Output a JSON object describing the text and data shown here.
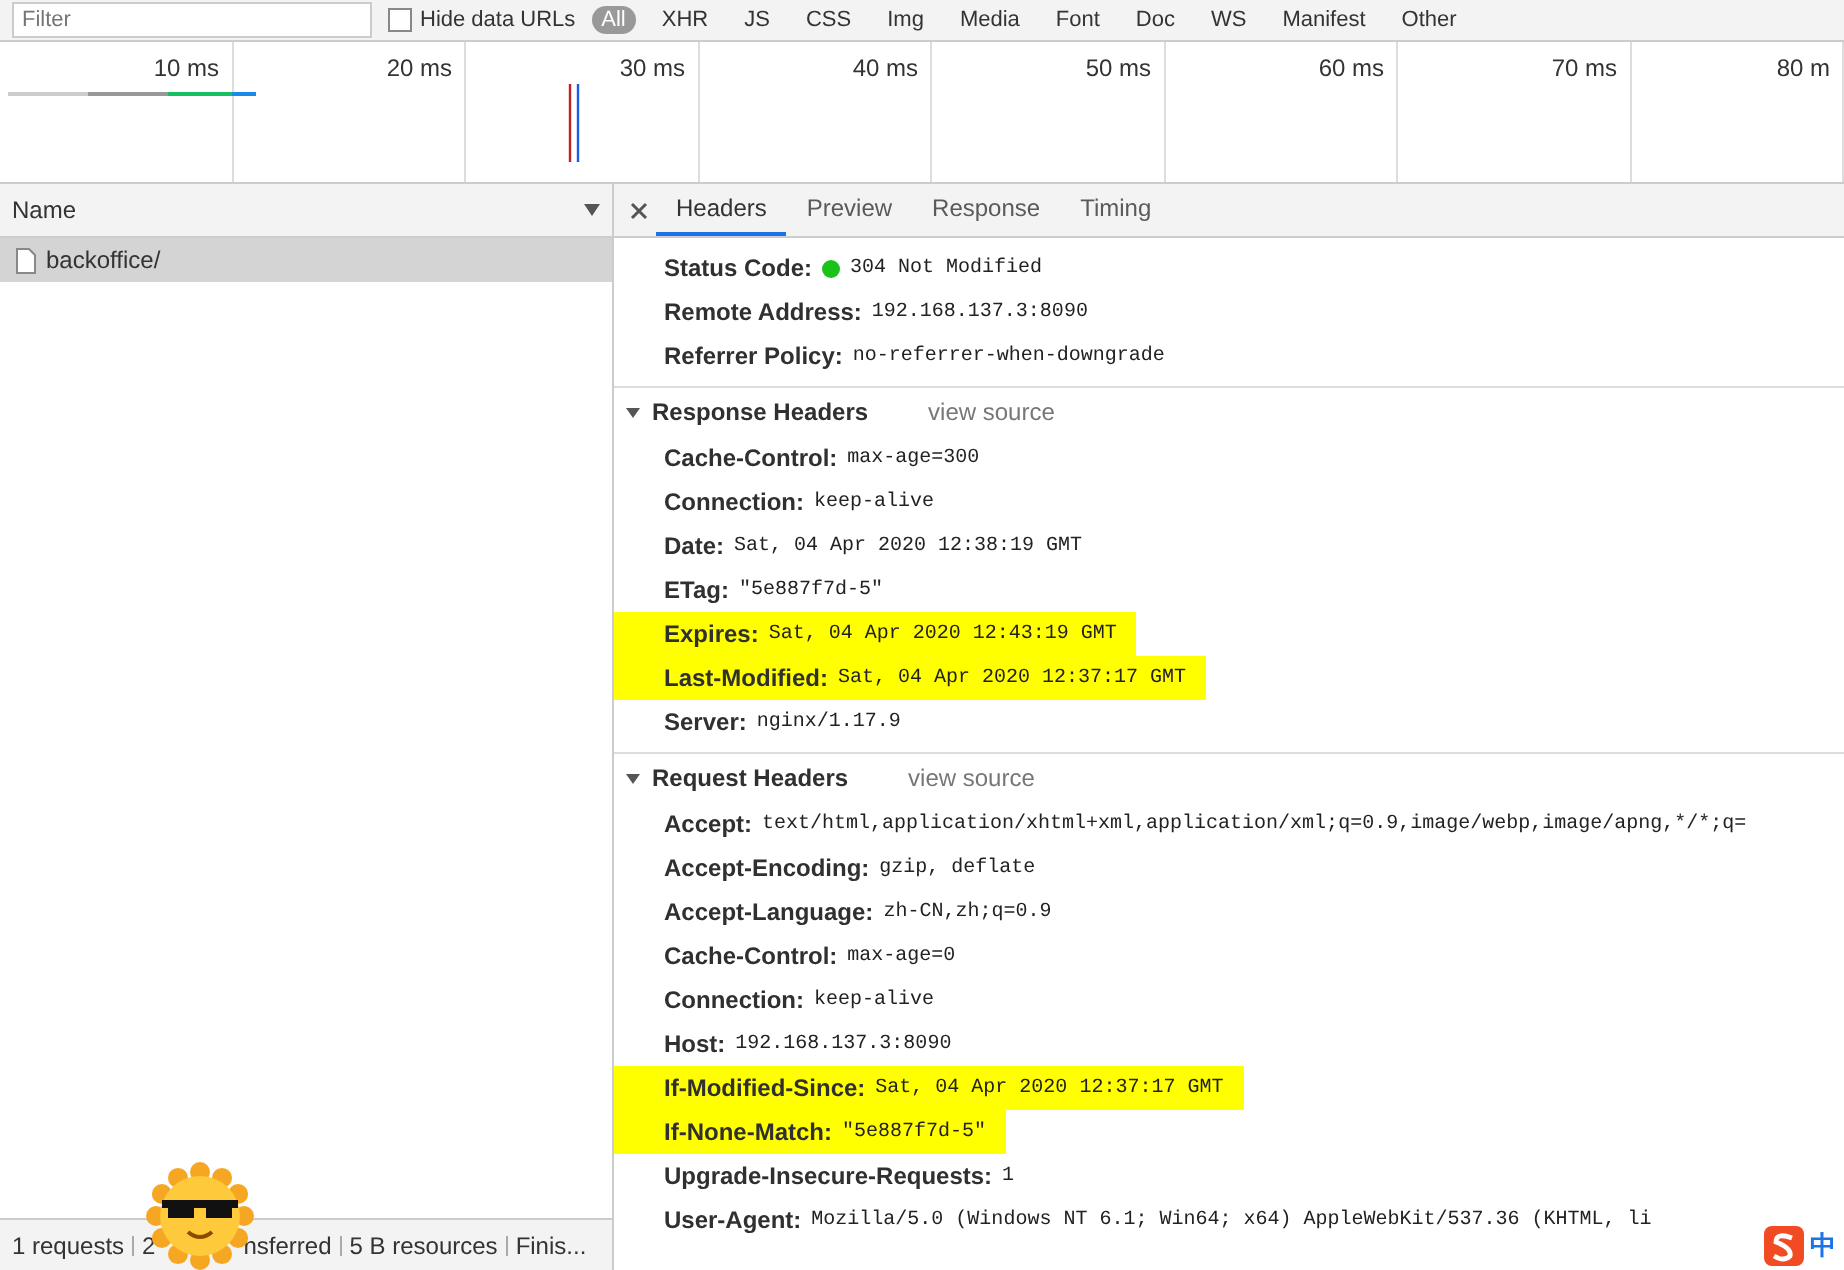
{
  "filter_bar": {
    "placeholder": "Filter",
    "hide_data_urls": {
      "label": "Hide data URLs",
      "checked": false
    },
    "types": [
      {
        "label": "All",
        "selected": true
      },
      {
        "label": "XHR",
        "selected": false
      },
      {
        "label": "JS",
        "selected": false
      },
      {
        "label": "CSS",
        "selected": false
      },
      {
        "label": "Img",
        "selected": false
      },
      {
        "label": "Media",
        "selected": false
      },
      {
        "label": "Font",
        "selected": false
      },
      {
        "label": "Doc",
        "selected": false
      },
      {
        "label": "WS",
        "selected": false
      },
      {
        "label": "Manifest",
        "selected": false
      },
      {
        "label": "Other",
        "selected": false
      }
    ]
  },
  "timeline": {
    "ticks": [
      "10 ms",
      "20 ms",
      "30 ms",
      "40 ms",
      "50 ms",
      "60 ms",
      "70 ms",
      "80 m"
    ]
  },
  "requests": {
    "column": "Name",
    "rows": [
      {
        "name": "backoffice/",
        "selected": true
      }
    ]
  },
  "status_bar": [
    "1 requests",
    "2",
    "nsferred",
    "5 B resources",
    "Finis..."
  ],
  "detail_tabs": [
    {
      "label": "Headers",
      "selected": true
    },
    {
      "label": "Preview",
      "selected": false
    },
    {
      "label": "Response",
      "selected": false
    },
    {
      "label": "Timing",
      "selected": false
    }
  ],
  "general": [
    {
      "name": "Status Code:",
      "value": "304 Not Modified",
      "kind": "status",
      "highlighted": false
    },
    {
      "name": "Remote Address:",
      "value": "192.168.137.3:8090",
      "kind": "plain",
      "highlighted": false
    },
    {
      "name": "Referrer Policy:",
      "value": "no-referrer-when-downgrade",
      "kind": "plain",
      "highlighted": false
    }
  ],
  "sections": [
    {
      "title": "Response Headers",
      "link": "view source",
      "expanded": true,
      "headers": [
        {
          "name": "Cache-Control:",
          "value": "max-age=300",
          "kind": "plain",
          "highlighted": false
        },
        {
          "name": "Connection:",
          "value": "keep-alive",
          "kind": "plain",
          "highlighted": false
        },
        {
          "name": "Date:",
          "value": "Sat, 04 Apr 2020 12:38:19 GMT",
          "kind": "plain",
          "highlighted": false
        },
        {
          "name": "ETag:",
          "value": "\"5e887f7d-5\"",
          "kind": "plain",
          "highlighted": false
        },
        {
          "name": "Expires:",
          "value": "Sat, 04 Apr 2020 12:43:19 GMT",
          "kind": "plain",
          "highlighted": true
        },
        {
          "name": "Last-Modified:",
          "value": "Sat, 04 Apr 2020 12:37:17 GMT",
          "kind": "plain",
          "highlighted": true
        },
        {
          "name": "Server:",
          "value": "nginx/1.17.9",
          "kind": "plain",
          "highlighted": false
        }
      ]
    },
    {
      "title": "Request Headers",
      "link": "view source",
      "expanded": true,
      "headers": [
        {
          "name": "Accept:",
          "value": "text/html,application/xhtml+xml,application/xml;q=0.9,image/webp,image/apng,*/*;q=",
          "kind": "plain",
          "highlighted": false
        },
        {
          "name": "Accept-Encoding:",
          "value": "gzip, deflate",
          "kind": "plain",
          "highlighted": false
        },
        {
          "name": "Accept-Language:",
          "value": "zh-CN,zh;q=0.9",
          "kind": "plain",
          "highlighted": false
        },
        {
          "name": "Cache-Control:",
          "value": "max-age=0",
          "kind": "plain",
          "highlighted": false
        },
        {
          "name": "Connection:",
          "value": "keep-alive",
          "kind": "plain",
          "highlighted": false
        },
        {
          "name": "Host:",
          "value": "192.168.137.3:8090",
          "kind": "plain",
          "highlighted": false
        },
        {
          "name": "If-Modified-Since:",
          "value": "Sat, 04 Apr 2020 12:37:17 GMT",
          "kind": "plain",
          "highlighted": true
        },
        {
          "name": "If-None-Match:",
          "value": "\"5e887f7d-5\"",
          "kind": "plain",
          "highlighted": true
        },
        {
          "name": "Upgrade-Insecure-Requests:",
          "value": "1",
          "kind": "plain",
          "highlighted": false
        },
        {
          "name": "User-Agent:",
          "value": "Mozilla/5.0 (Windows NT 6.1; Win64; x64) AppleWebKit/537.36 (KHTML, li",
          "kind": "plain",
          "highlighted": false
        }
      ]
    }
  ],
  "ime_badge": "中"
}
